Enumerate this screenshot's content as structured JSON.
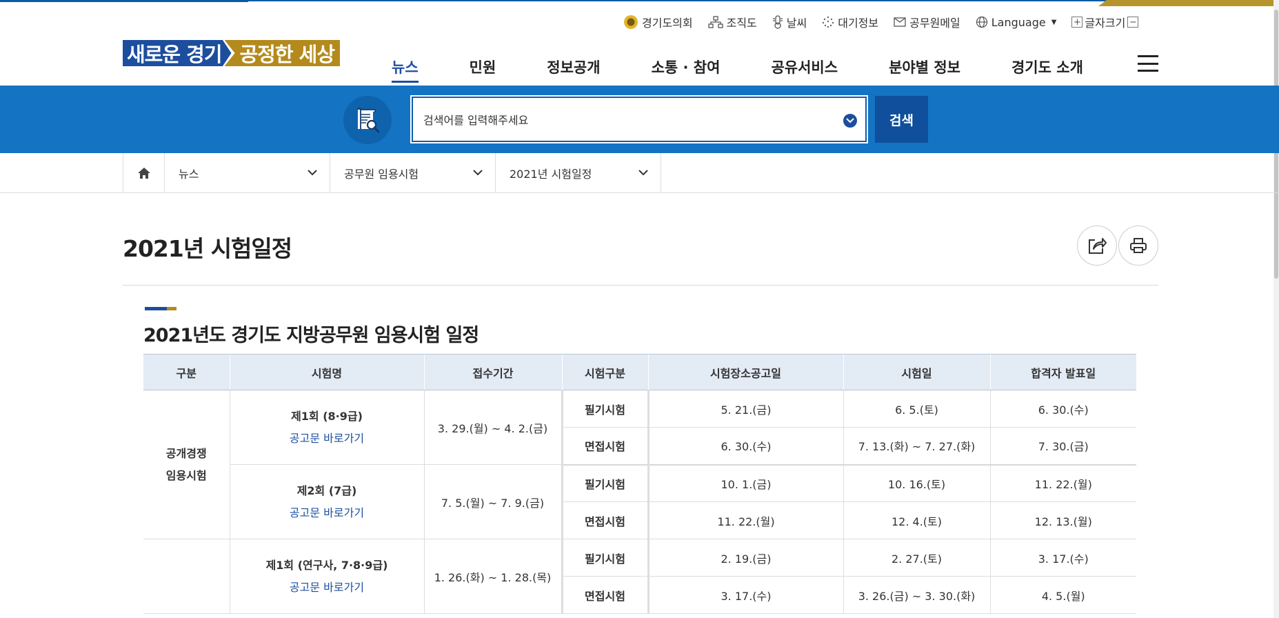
{
  "utility": {
    "council": "경기도의회",
    "org_chart": "조직도",
    "weather": "날씨",
    "air": "대기정보",
    "mail": "공무원메일",
    "language": "Language",
    "font_size": "글자크기"
  },
  "logo": {
    "part1": "새로운 경기",
    "part2": "공정한 세상"
  },
  "nav": {
    "items": [
      "뉴스",
      "민원",
      "정보공개",
      "소통 · 참여",
      "공유서비스",
      "분야별 정보",
      "경기도 소개"
    ],
    "active_index": 0
  },
  "search": {
    "placeholder": "검색어를 입력해주세요",
    "button": "검색"
  },
  "breadcrumb": [
    "뉴스",
    "공무원 임용시험",
    "2021년 시험일정"
  ],
  "page_title": "2021년 시험일정",
  "section_title": "2021년도 경기도 지방공무원 임용시험 일정",
  "table": {
    "headers": [
      "구분",
      "시험명",
      "접수기간",
      "시험구분",
      "시험장소공고일",
      "시험일",
      "합격자 발표일"
    ],
    "category1": "공개경쟁\n임용시험",
    "link_label": "공고문 바로가기",
    "rounds": [
      {
        "name": "제1회 (8·9급)",
        "period": "3. 29.(월) ~ 4. 2.(금)",
        "rows": [
          {
            "type": "필기시험",
            "notice": "5. 21.(금)",
            "exam": "6. 5.(토)",
            "result": "6. 30.(수)"
          },
          {
            "type": "면접시험",
            "notice": "6. 30.(수)",
            "exam": "7. 13.(화) ~ 7. 27.(화)",
            "result": "7. 30.(금)"
          }
        ]
      },
      {
        "name": "제2회 (7급)",
        "period": "7. 5.(월) ~ 7. 9.(금)",
        "rows": [
          {
            "type": "필기시험",
            "notice": "10. 1.(금)",
            "exam": "10. 16.(토)",
            "result": "11. 22.(월)"
          },
          {
            "type": "면접시험",
            "notice": "11. 22.(월)",
            "exam": "12. 4.(토)",
            "result": "12. 13.(월)"
          }
        ]
      },
      {
        "name": "제1회 (연구사, 7·8·9급)",
        "period": "1. 26.(화) ~ 1. 28.(목)",
        "rows": [
          {
            "type": "필기시험",
            "notice": "2. 19.(금)",
            "exam": "2. 27.(토)",
            "result": "3. 17.(수)"
          },
          {
            "type": "면접시험",
            "notice": "3. 17.(수)",
            "exam": "3. 26.(금) ~ 3. 30.(화)",
            "result": "4. 5.(월)"
          }
        ]
      }
    ]
  },
  "colors": {
    "primary": "#1d4e9e",
    "band": "#1473c3",
    "gold": "#b48a1d",
    "header_bg": "#e3ebf5"
  }
}
